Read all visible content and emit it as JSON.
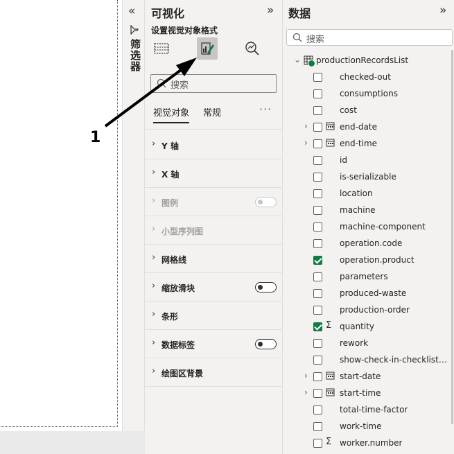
{
  "filters": {
    "collapse_glyph": "«",
    "label": "筛选器"
  },
  "visualizations": {
    "title": "可视化",
    "expand_glyph": "»",
    "subtitle": "设置视觉对象格式",
    "search_placeholder": "搜索",
    "tabs": [
      "视觉对象",
      "常规"
    ],
    "more": "···",
    "sections": [
      {
        "label": "Y 轴",
        "disabled": false,
        "toggle": null
      },
      {
        "label": "X 轴",
        "disabled": false,
        "toggle": null
      },
      {
        "label": "图例",
        "disabled": true,
        "toggle": "off"
      },
      {
        "label": "小型序列图",
        "disabled": true,
        "toggle": null
      },
      {
        "label": "网格线",
        "disabled": false,
        "toggle": null
      },
      {
        "label": "缩放滑块",
        "disabled": false,
        "toggle": "off"
      },
      {
        "label": "条形",
        "disabled": false,
        "toggle": null
      },
      {
        "label": "数据标签",
        "disabled": false,
        "toggle": "off"
      },
      {
        "label": "绘图区背景",
        "disabled": false,
        "toggle": null
      }
    ]
  },
  "data_pane": {
    "title": "数据",
    "expand_glyph": "»",
    "search_placeholder": "搜索",
    "table_name": "productionRecordsList",
    "fields": [
      {
        "name": "checked-out",
        "checked": false,
        "expandable": false,
        "icon": ""
      },
      {
        "name": "consumptions",
        "checked": false,
        "expandable": false,
        "icon": ""
      },
      {
        "name": "cost",
        "checked": false,
        "expandable": false,
        "icon": ""
      },
      {
        "name": "end-date",
        "checked": false,
        "expandable": true,
        "icon": "calendar-icon"
      },
      {
        "name": "end-time",
        "checked": false,
        "expandable": true,
        "icon": "calendar-icon"
      },
      {
        "name": "id",
        "checked": false,
        "expandable": false,
        "icon": ""
      },
      {
        "name": "is-serializable",
        "checked": false,
        "expandable": false,
        "icon": ""
      },
      {
        "name": "location",
        "checked": false,
        "expandable": false,
        "icon": ""
      },
      {
        "name": "machine",
        "checked": false,
        "expandable": false,
        "icon": ""
      },
      {
        "name": "machine-component",
        "checked": false,
        "expandable": false,
        "icon": ""
      },
      {
        "name": "operation.code",
        "checked": false,
        "expandable": false,
        "icon": ""
      },
      {
        "name": "operation.product",
        "checked": true,
        "expandable": false,
        "icon": ""
      },
      {
        "name": "parameters",
        "checked": false,
        "expandable": false,
        "icon": ""
      },
      {
        "name": "produced-waste",
        "checked": false,
        "expandable": false,
        "icon": ""
      },
      {
        "name": "production-order",
        "checked": false,
        "expandable": false,
        "icon": ""
      },
      {
        "name": "quantity",
        "checked": true,
        "expandable": false,
        "icon": "sigma-icon"
      },
      {
        "name": "rework",
        "checked": false,
        "expandable": false,
        "icon": ""
      },
      {
        "name": "show-check-in-checklist-an...",
        "checked": false,
        "expandable": false,
        "icon": ""
      },
      {
        "name": "start-date",
        "checked": false,
        "expandable": true,
        "icon": "calendar-icon"
      },
      {
        "name": "start-time",
        "checked": false,
        "expandable": true,
        "icon": "calendar-icon"
      },
      {
        "name": "total-time-factor",
        "checked": false,
        "expandable": false,
        "icon": ""
      },
      {
        "name": "work-time",
        "checked": false,
        "expandable": false,
        "icon": ""
      },
      {
        "name": "worker.number",
        "checked": false,
        "expandable": false,
        "icon": "sigma-icon"
      }
    ]
  },
  "annotation": {
    "number": "1"
  },
  "colors": {
    "accent_green": "#107c41",
    "pane_bg": "#f3f2f1"
  }
}
